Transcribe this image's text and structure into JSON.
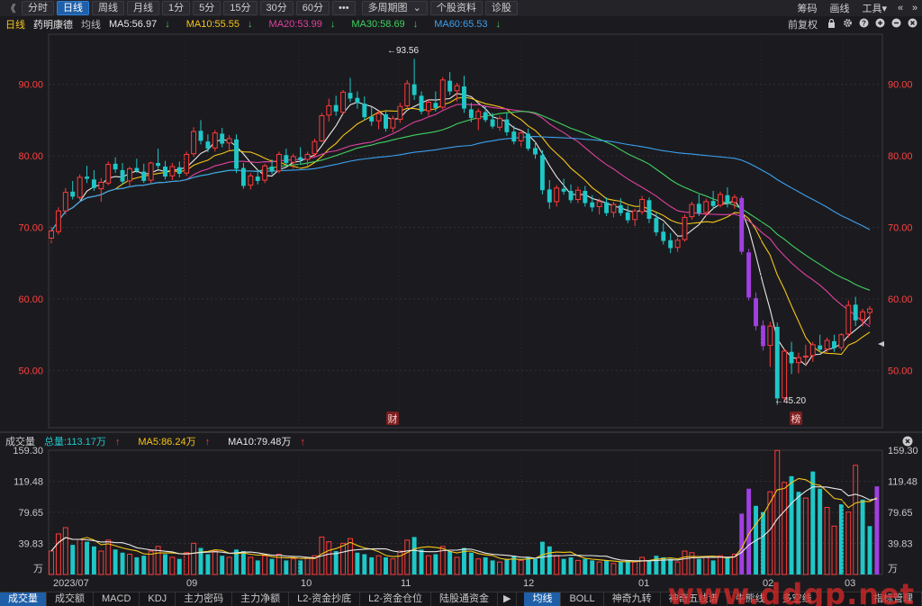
{
  "toolbar": {
    "back": "《",
    "periods": [
      "分时",
      "日线",
      "周线",
      "月线",
      "1分",
      "5分",
      "15分",
      "30分",
      "60分",
      "•••"
    ],
    "active_period": "日线",
    "multi_period": "多周期图",
    "multi_period_arrow": "⌄",
    "stock_info": "个股资料",
    "diagnose": "诊股",
    "right_links": [
      "筹码",
      "画线"
    ],
    "tools": "工具",
    "tools_arrow": "▾",
    "window_icons": [
      "«",
      "»"
    ]
  },
  "header": {
    "period": "日线",
    "stock_name": "药明康德",
    "ma_label": "均线",
    "ma": [
      {
        "text": "MA5:56.97",
        "arrow": "↓",
        "color": "#e8e8e8"
      },
      {
        "text": "MA10:55.55",
        "arrow": "↓",
        "color": "#f5c518"
      },
      {
        "text": "MA20:53.99",
        "arrow": "↓",
        "color": "#e040a0"
      },
      {
        "text": "MA30:58.69",
        "arrow": "↓",
        "color": "#40d060"
      },
      {
        "text": "MA60:65.53",
        "arrow": "↓",
        "color": "#3ba0f0"
      }
    ],
    "adjust": "前复权"
  },
  "volume_header": {
    "label": "成交量",
    "total": "总量:113.17万",
    "total_arrow": "↑",
    "ma5": "MA5:86.24万",
    "ma5_arrow": "↑",
    "ma10": "MA10:79.48万",
    "ma10_arrow": "↑"
  },
  "colors": {
    "up": "#ff3b3b",
    "down": "#1fc7c7",
    "ma5": "#e8e8e8",
    "ma10": "#f5c518",
    "ma20": "#e040a0",
    "ma30": "#40d060",
    "ma60": "#3ba0f0",
    "purple": "#a040e0",
    "axis_red": "#ff4040"
  },
  "price_axis": {
    "ticks": [
      "90.00",
      "80.00",
      "70.00",
      "60.00",
      "50.00"
    ],
    "values": [
      90,
      80,
      70,
      60,
      50
    ],
    "min": 42,
    "max": 97
  },
  "volume_axis": {
    "ticks": [
      "159.30",
      "119.48",
      "79.65",
      "39.83",
      "万"
    ]
  },
  "x_axis": {
    "labels": [
      "2023/07",
      "09",
      "10",
      "11",
      "12",
      "01",
      "02",
      "03"
    ]
  },
  "annotations": {
    "high": "←93.56",
    "low": "←45.20",
    "event1": "财",
    "event2": "榜"
  },
  "chart_data": {
    "type": "candlestick",
    "title": "药明康德",
    "price_range": [
      42,
      97
    ],
    "high_label": 93.56,
    "low_label": 45.2,
    "ma_latest": {
      "MA5": 56.97,
      "MA10": 55.55,
      "MA20": 53.99,
      "MA30": 58.69,
      "MA60": 65.53
    },
    "volume_latest": {
      "total": "113.17万",
      "MA5": "86.24万",
      "MA10": "79.48万"
    },
    "volume_range": [
      0,
      159.3
    ],
    "candles": [
      [
        68.5,
        70.1,
        67.8,
        69.5
      ],
      [
        69.4,
        72.8,
        69.0,
        72.3
      ],
      [
        72.3,
        75.5,
        71.8,
        74.9
      ],
      [
        75.0,
        76.5,
        73.9,
        74.3
      ],
      [
        74.2,
        77.4,
        73.9,
        77.0
      ],
      [
        77.1,
        78.6,
        76.2,
        76.8
      ],
      [
        76.7,
        78.0,
        75.1,
        75.5
      ],
      [
        75.4,
        76.9,
        73.6,
        76.3
      ],
      [
        76.2,
        79.2,
        75.9,
        78.8
      ],
      [
        78.9,
        79.8,
        77.6,
        78.1
      ],
      [
        78.0,
        79.0,
        76.0,
        76.4
      ],
      [
        76.5,
        78.5,
        75.8,
        78.2
      ],
      [
        78.3,
        79.6,
        77.6,
        77.9
      ],
      [
        77.8,
        78.9,
        76.2,
        76.5
      ],
      [
        76.6,
        79.2,
        76.2,
        79.0
      ],
      [
        79.0,
        81.0,
        78.2,
        78.6
      ],
      [
        78.5,
        79.3,
        76.7,
        77.1
      ],
      [
        77.2,
        79.0,
        76.6,
        78.5
      ],
      [
        78.4,
        79.2,
        77.0,
        77.5
      ],
      [
        77.6,
        80.6,
        77.2,
        80.2
      ],
      [
        80.3,
        84.0,
        79.9,
        83.4
      ],
      [
        83.5,
        85.0,
        81.6,
        82.1
      ],
      [
        82.0,
        83.0,
        80.5,
        81.0
      ],
      [
        81.1,
        83.6,
        80.6,
        83.2
      ],
      [
        83.1,
        83.9,
        81.2,
        81.7
      ],
      [
        81.8,
        82.9,
        80.8,
        82.4
      ],
      [
        82.3,
        83.0,
        77.6,
        78.2
      ],
      [
        78.3,
        79.0,
        75.4,
        75.8
      ],
      [
        75.9,
        77.6,
        75.3,
        77.2
      ],
      [
        77.1,
        78.1,
        76.0,
        76.5
      ],
      [
        76.6,
        78.9,
        76.2,
        78.6
      ],
      [
        78.5,
        79.5,
        77.4,
        77.8
      ],
      [
        77.9,
        80.6,
        77.6,
        80.2
      ],
      [
        80.1,
        81.0,
        78.6,
        79.0
      ],
      [
        79.1,
        80.3,
        78.2,
        79.9
      ],
      [
        79.8,
        81.2,
        78.9,
        79.4
      ],
      [
        79.5,
        80.6,
        78.6,
        80.2
      ],
      [
        80.3,
        82.4,
        79.9,
        82.0
      ],
      [
        82.1,
        86.0,
        81.9,
        85.6
      ],
      [
        85.7,
        88.0,
        84.8,
        87.0
      ],
      [
        87.1,
        88.4,
        85.6,
        86.2
      ],
      [
        86.1,
        89.2,
        85.8,
        88.9
      ],
      [
        88.8,
        90.9,
        87.5,
        88.0
      ],
      [
        88.1,
        89.0,
        86.6,
        87.4
      ],
      [
        87.3,
        88.3,
        85.0,
        85.4
      ],
      [
        85.5,
        86.8,
        84.2,
        84.8
      ],
      [
        84.9,
        86.3,
        83.7,
        85.9
      ],
      [
        85.8,
        86.2,
        83.4,
        83.8
      ],
      [
        83.9,
        85.6,
        83.3,
        85.2
      ],
      [
        85.1,
        87.4,
        84.6,
        86.9
      ],
      [
        87.0,
        90.6,
        86.6,
        90.1
      ],
      [
        90.0,
        93.56,
        87.8,
        88.5
      ],
      [
        88.4,
        89.0,
        85.8,
        86.2
      ],
      [
        86.3,
        87.9,
        85.6,
        87.5
      ],
      [
        87.4,
        89.0,
        86.2,
        86.7
      ],
      [
        86.8,
        91.0,
        86.5,
        90.6
      ],
      [
        90.5,
        91.7,
        88.5,
        89.0
      ],
      [
        89.1,
        90.2,
        87.6,
        89.8
      ],
      [
        89.7,
        91.2,
        86.0,
        86.6
      ],
      [
        86.5,
        87.4,
        84.7,
        85.3
      ],
      [
        85.2,
        86.6,
        83.6,
        86.2
      ],
      [
        86.1,
        87.0,
        84.7,
        85.0
      ],
      [
        85.1,
        86.0,
        83.8,
        84.1
      ],
      [
        84.0,
        85.6,
        83.5,
        85.2
      ],
      [
        85.1,
        86.0,
        82.8,
        83.3
      ],
      [
        83.4,
        84.2,
        81.6,
        82.0
      ],
      [
        82.1,
        83.6,
        81.2,
        83.2
      ],
      [
        83.1,
        83.8,
        80.7,
        81.0
      ],
      [
        81.1,
        82.0,
        79.6,
        80.2
      ],
      [
        80.1,
        80.8,
        74.6,
        75.2
      ],
      [
        75.3,
        76.6,
        72.6,
        73.5
      ],
      [
        73.6,
        75.9,
        72.9,
        75.5
      ],
      [
        75.4,
        76.8,
        74.6,
        75.0
      ],
      [
        75.1,
        76.0,
        73.4,
        73.8
      ],
      [
        73.9,
        75.7,
        73.4,
        75.2
      ],
      [
        75.1,
        75.8,
        72.9,
        73.4
      ],
      [
        73.5,
        74.5,
        72.2,
        72.8
      ],
      [
        72.9,
        74.0,
        71.8,
        73.6
      ],
      [
        73.5,
        74.2,
        71.6,
        72.0
      ],
      [
        72.1,
        73.6,
        71.4,
        73.2
      ],
      [
        73.1,
        74.1,
        71.6,
        72.0
      ],
      [
        72.1,
        73.0,
        70.6,
        71.0
      ],
      [
        71.1,
        72.6,
        70.2,
        72.3
      ],
      [
        72.2,
        74.4,
        71.8,
        73.9
      ],
      [
        73.8,
        74.2,
        70.6,
        71.2
      ],
      [
        71.3,
        72.0,
        68.8,
        69.3
      ],
      [
        69.4,
        70.6,
        67.6,
        68.1
      ],
      [
        68.2,
        69.2,
        66.4,
        67.1
      ],
      [
        67.2,
        68.6,
        66.6,
        68.2
      ],
      [
        68.3,
        71.8,
        68.0,
        71.4
      ],
      [
        71.5,
        73.6,
        71.1,
        73.2
      ],
      [
        73.3,
        74.6,
        71.6,
        72.0
      ],
      [
        72.1,
        74.0,
        71.6,
        73.6
      ],
      [
        73.7,
        75.1,
        72.6,
        73.0
      ],
      [
        73.1,
        75.0,
        72.8,
        74.6
      ],
      [
        74.5,
        75.6,
        72.8,
        73.4
      ],
      [
        73.5,
        74.6,
        72.6,
        74.2
      ],
      [
        74.1,
        74.4,
        66.2,
        66.6
      ],
      [
        66.5,
        67.0,
        59.8,
        60.2
      ],
      [
        60.1,
        60.9,
        55.6,
        56.2
      ],
      [
        56.3,
        57.0,
        52.8,
        53.4
      ],
      [
        53.5,
        56.8,
        50.5,
        56.2
      ],
      [
        56.1,
        56.7,
        45.2,
        46.1
      ],
      [
        46.2,
        53.0,
        45.6,
        52.7
      ],
      [
        52.6,
        54.0,
        49.5,
        51.0
      ],
      [
        51.1,
        52.5,
        49.6,
        51.8
      ],
      [
        51.9,
        53.6,
        50.7,
        52.0
      ],
      [
        52.1,
        54.0,
        51.2,
        53.6
      ],
      [
        53.5,
        55.0,
        52.5,
        52.9
      ],
      [
        53.0,
        54.6,
        52.4,
        54.2
      ],
      [
        54.1,
        55.0,
        52.6,
        53.1
      ],
      [
        53.2,
        55.2,
        52.8,
        55.0
      ],
      [
        55.1,
        59.8,
        54.6,
        59.1
      ],
      [
        59.2,
        60.3,
        56.2,
        57.0
      ],
      [
        57.1,
        58.6,
        56.2,
        58.2
      ],
      [
        58.1,
        59.0,
        56.4,
        58.6
      ]
    ],
    "volumes": [
      [
        30,
        1
      ],
      [
        52,
        1
      ],
      [
        60,
        1
      ],
      [
        38,
        0
      ],
      [
        45,
        1
      ],
      [
        42,
        0
      ],
      [
        36,
        0
      ],
      [
        30,
        1
      ],
      [
        44,
        1
      ],
      [
        32,
        0
      ],
      [
        28,
        0
      ],
      [
        26,
        1
      ],
      [
        22,
        0
      ],
      [
        24,
        0
      ],
      [
        30,
        1
      ],
      [
        36,
        1
      ],
      [
        26,
        0
      ],
      [
        22,
        1
      ],
      [
        20,
        0
      ],
      [
        28,
        1
      ],
      [
        40,
        1
      ],
      [
        34,
        0
      ],
      [
        26,
        0
      ],
      [
        30,
        1
      ],
      [
        24,
        0
      ],
      [
        22,
        1
      ],
      [
        32,
        0
      ],
      [
        30,
        0
      ],
      [
        22,
        1
      ],
      [
        18,
        0
      ],
      [
        24,
        1
      ],
      [
        20,
        0
      ],
      [
        26,
        1
      ],
      [
        18,
        0
      ],
      [
        20,
        1
      ],
      [
        18,
        0
      ],
      [
        22,
        1
      ],
      [
        24,
        1
      ],
      [
        48,
        1
      ],
      [
        42,
        1
      ],
      [
        30,
        0
      ],
      [
        40,
        1
      ],
      [
        46,
        1
      ],
      [
        28,
        0
      ],
      [
        26,
        0
      ],
      [
        22,
        0
      ],
      [
        24,
        1
      ],
      [
        22,
        0
      ],
      [
        20,
        1
      ],
      [
        30,
        1
      ],
      [
        44,
        1
      ],
      [
        48,
        0
      ],
      [
        32,
        0
      ],
      [
        24,
        1
      ],
      [
        26,
        0
      ],
      [
        36,
        1
      ],
      [
        30,
        0
      ],
      [
        22,
        1
      ],
      [
        34,
        0
      ],
      [
        28,
        0
      ],
      [
        20,
        1
      ],
      [
        22,
        0
      ],
      [
        18,
        0
      ],
      [
        16,
        1
      ],
      [
        20,
        0
      ],
      [
        24,
        0
      ],
      [
        18,
        1
      ],
      [
        22,
        0
      ],
      [
        20,
        0
      ],
      [
        42,
        0
      ],
      [
        36,
        0
      ],
      [
        24,
        1
      ],
      [
        20,
        0
      ],
      [
        22,
        0
      ],
      [
        18,
        1
      ],
      [
        20,
        0
      ],
      [
        18,
        0
      ],
      [
        16,
        1
      ],
      [
        18,
        0
      ],
      [
        14,
        1
      ],
      [
        16,
        0
      ],
      [
        18,
        0
      ],
      [
        16,
        1
      ],
      [
        22,
        1
      ],
      [
        18,
        0
      ],
      [
        24,
        0
      ],
      [
        22,
        0
      ],
      [
        20,
        0
      ],
      [
        16,
        1
      ],
      [
        30,
        1
      ],
      [
        28,
        1
      ],
      [
        20,
        0
      ],
      [
        22,
        1
      ],
      [
        18,
        0
      ],
      [
        24,
        1
      ],
      [
        22,
        0
      ],
      [
        26,
        1
      ],
      [
        78,
        2
      ],
      [
        110,
        2
      ],
      [
        88,
        0
      ],
      [
        80,
        0
      ],
      [
        106,
        1
      ],
      [
        159,
        1
      ],
      [
        118,
        1
      ],
      [
        126,
        0
      ],
      [
        106,
        0
      ],
      [
        98,
        1
      ],
      [
        132,
        0
      ],
      [
        110,
        0
      ],
      [
        86,
        1
      ],
      [
        62,
        1
      ],
      [
        90,
        0
      ],
      [
        80,
        1
      ],
      [
        140,
        1
      ],
      [
        96,
        0
      ],
      [
        62,
        0
      ],
      [
        113,
        2
      ]
    ]
  }
}
